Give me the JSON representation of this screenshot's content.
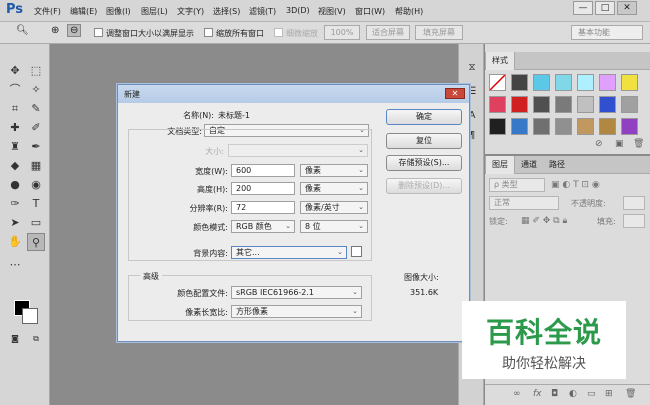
{
  "app": {
    "logo": "Ps"
  },
  "menubar": {
    "items": [
      "文件(F)",
      "编辑(E)",
      "图像(I)",
      "图层(L)",
      "文字(Y)",
      "选择(S)",
      "滤镜(T)",
      "3D(D)",
      "视图(V)",
      "窗口(W)",
      "帮助(H)"
    ],
    "win_min": "—",
    "win_max": "□",
    "win_close": "✕"
  },
  "options": {
    "resize_label": "调整窗口大小以满屏显示",
    "zoom_all_label": "缩放所有窗口",
    "scrubby_label": "细微缩放",
    "zoom_pct": "100%",
    "fit_screen": "适合屏幕",
    "fill_screen": "填充屏幕",
    "workspace": "基本功能"
  },
  "styles_panel": {
    "tab": "样式",
    "swatch_colors": [
      "#ffffff",
      "#444444",
      "#5bc8e8",
      "#7fd7e8",
      "#aef0ff",
      "#e0a0ff",
      "#f0e040",
      "#e04060",
      "#d02020",
      "#505050",
      "#7a7a7a",
      "#c0c0c0",
      "#3050d0",
      "#a0a0a0",
      "#202020",
      "#3878c8",
      "#707070",
      "#909090",
      "#c09860",
      "#b08840",
      "#9040c0"
    ]
  },
  "layers_panel": {
    "tabs": [
      "图层",
      "通道",
      "路径"
    ],
    "filter": "ρ 类型",
    "blend_mode": "正常",
    "opacity_label": "不透明度:",
    "lock_label": "锁定:",
    "fill_label": "填充:"
  },
  "dialog": {
    "title": "新建",
    "name_label": "名称(N):",
    "name_value": "未标题-1",
    "preset_label": "文档类型:",
    "preset_value": "自定",
    "size_label": "大小:",
    "width_label": "宽度(W):",
    "width_value": "600",
    "width_unit": "像素",
    "height_label": "高度(H):",
    "height_value": "200",
    "height_unit": "像素",
    "resolution_label": "分辨率(R):",
    "resolution_value": "72",
    "resolution_unit": "像素/英寸",
    "color_mode_label": "颜色模式:",
    "color_mode_value": "RGB 颜色",
    "bit_depth": "8 位",
    "bg_label": "背景内容:",
    "bg_value": "其它...",
    "advanced_label": "高级",
    "color_profile_label": "颜色配置文件:",
    "color_profile_value": "sRGB IEC61966-2.1",
    "pixel_aspect_label": "像素长宽比:",
    "pixel_aspect_value": "方形像素",
    "image_size_label": "图像大小:",
    "image_size_value": "351.6K",
    "ok": "确定",
    "reset": "复位",
    "save_preset": "存储预设(S)...",
    "delete_preset": "删除预设(D)..."
  },
  "watermark": {
    "main": "百科全说",
    "sub": "助你轻松解决"
  }
}
